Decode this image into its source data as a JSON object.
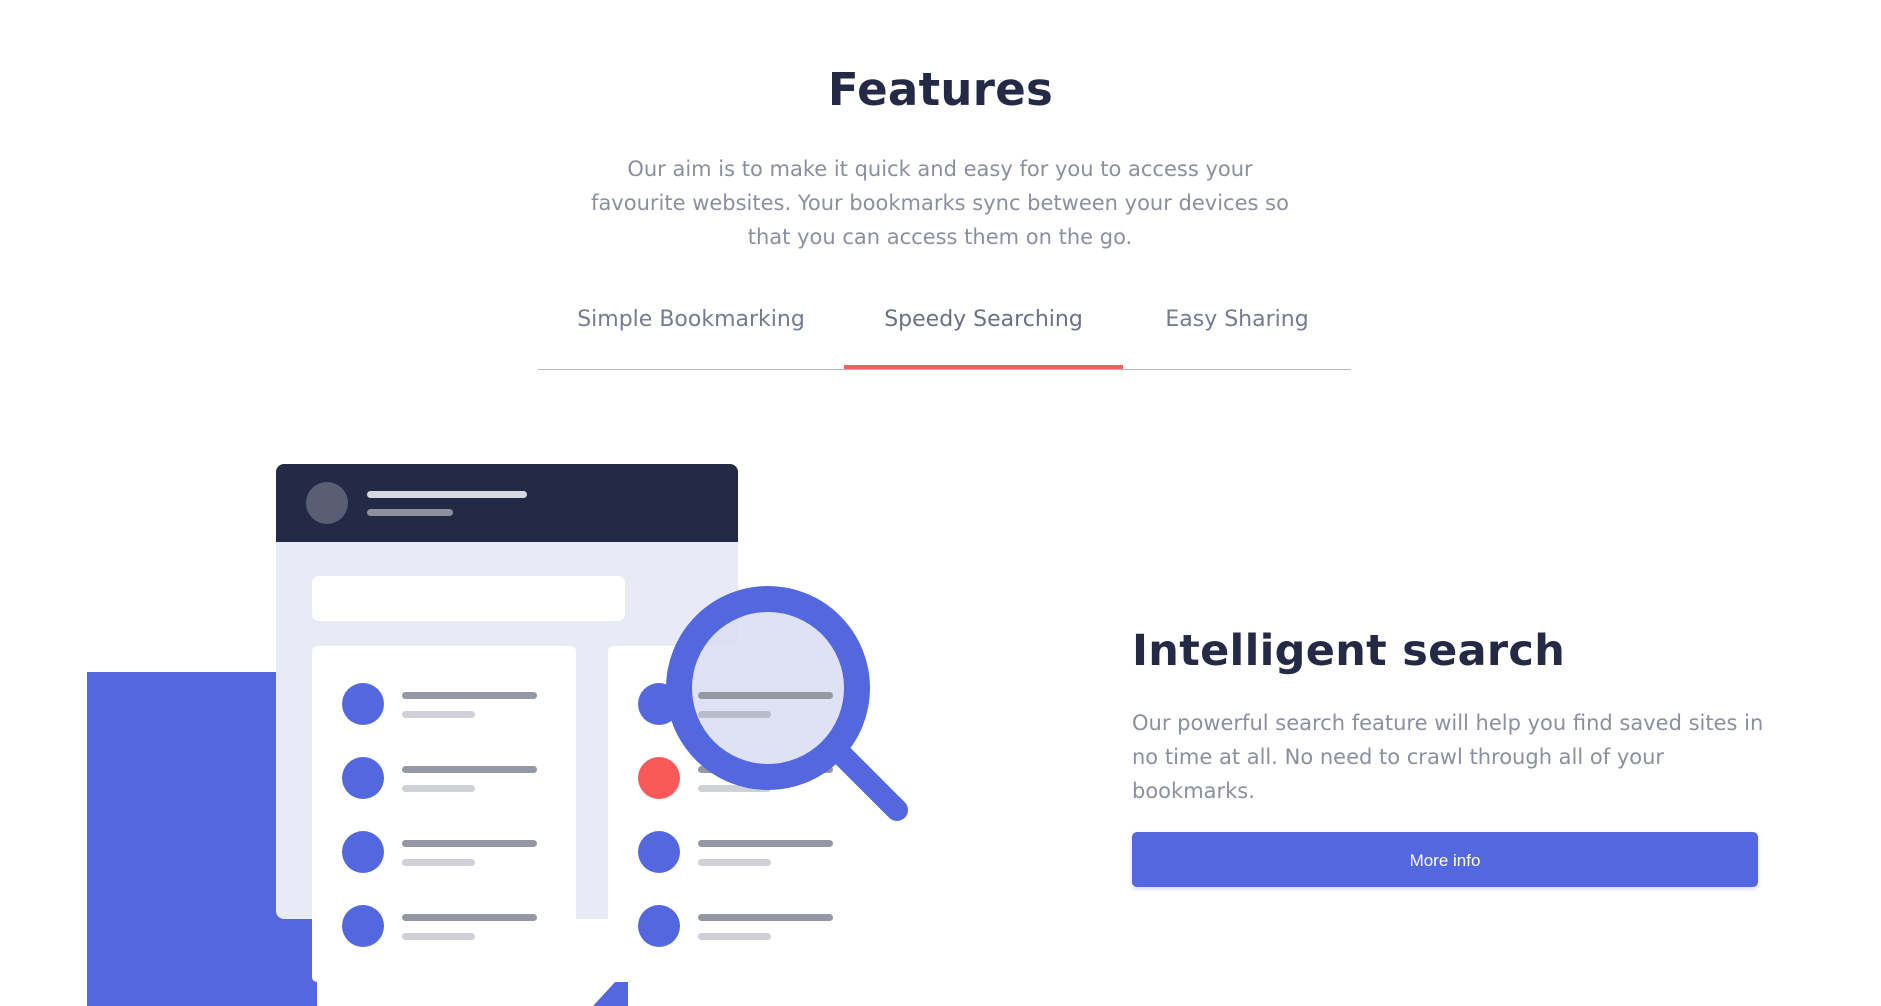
{
  "colors": {
    "primary_blue": "#5368DF",
    "accent_red": "#FA5959",
    "dark_navy": "#242A45",
    "text_grey": "#8C8F9E",
    "panel_lavender": "#E8EAF6"
  },
  "section": {
    "title": "Features",
    "intro": "Our aim is to make it quick and easy for you to access your favourite websites. Your bookmarks sync between your devices so that you can access them on the go."
  },
  "tabs": [
    {
      "label": "Simple Bookmarking",
      "active": false
    },
    {
      "label": "Speedy Searching",
      "active": true
    },
    {
      "label": "Easy Sharing",
      "active": false
    }
  ],
  "feature": {
    "title": "Intelligent search",
    "text": "Our powerful search feature will help you find saved sites in no time at all. No need to crawl through all of your bookmarks.",
    "button_label": "More info"
  },
  "illustration": {
    "icons": [
      "avatar-circle-icon",
      "magnifier-icon",
      "list-dot-icon"
    ]
  }
}
